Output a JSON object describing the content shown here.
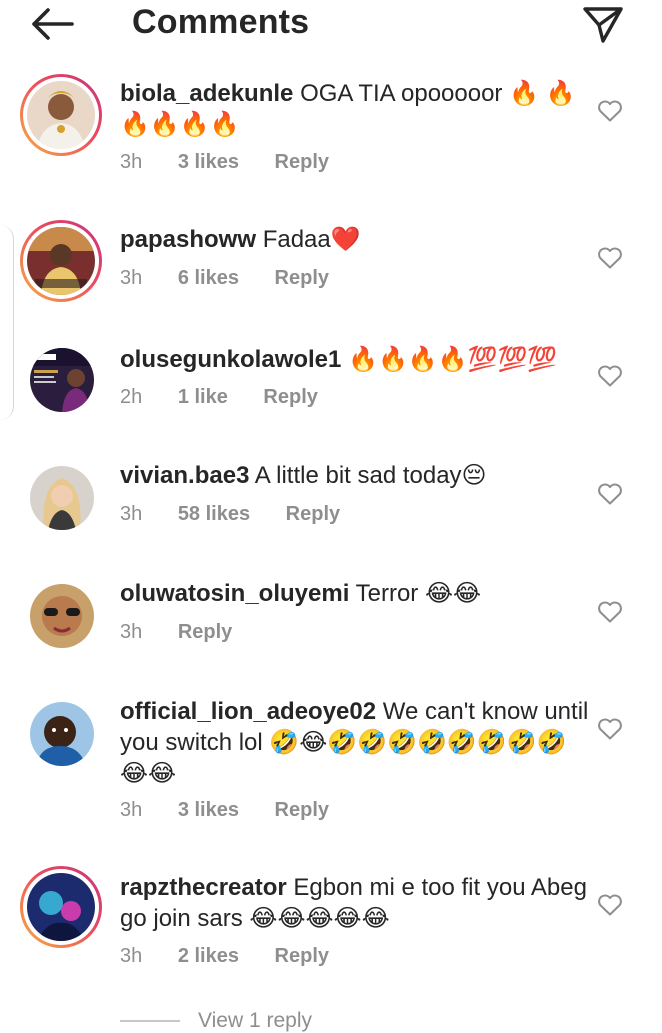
{
  "header": {
    "title": "Comments"
  },
  "comments": [
    {
      "username": "biola_adekunle",
      "text": "OGA TIA opooooor 🔥 🔥🔥🔥🔥🔥",
      "time": "3h",
      "likes": "3 likes",
      "reply": "Reply"
    },
    {
      "username": "papashoww",
      "text": "Fadaa❤️",
      "time": "3h",
      "likes": "6 likes",
      "reply": "Reply"
    },
    {
      "username": "olusegunkolawole1",
      "text": "🔥🔥🔥🔥💯💯💯",
      "time": "2h",
      "likes": "1 like",
      "reply": "Reply"
    },
    {
      "username": "vivian.bae3",
      "text": "A little bit sad today😔",
      "time": "3h",
      "likes": "58 likes",
      "reply": "Reply"
    },
    {
      "username": "oluwatosin_oluyemi",
      "text": "Terror 😂😂",
      "time": "3h",
      "likes": "",
      "reply": "Reply"
    },
    {
      "username": "official_lion_adeoye02",
      "text": "We can't know until you switch lol 🤣😂🤣🤣🤣🤣🤣🤣🤣🤣😂😂",
      "time": "3h",
      "likes": "3 likes",
      "reply": "Reply"
    },
    {
      "username": "rapzthecreator",
      "text": "Egbon mi e too fit you Abeg go join sars 😂😂😂😂😂",
      "time": "3h",
      "likes": "2 likes",
      "reply": "Reply"
    }
  ],
  "view_replies": {
    "label": "View 1 reply"
  },
  "icons": {
    "back": "arrow-left-icon",
    "send": "paper-plane-icon",
    "like": "heart-outline-icon"
  },
  "colors": {
    "text": "#262626",
    "muted": "#8e8e8e",
    "story_ring": "#ee4b5d"
  }
}
